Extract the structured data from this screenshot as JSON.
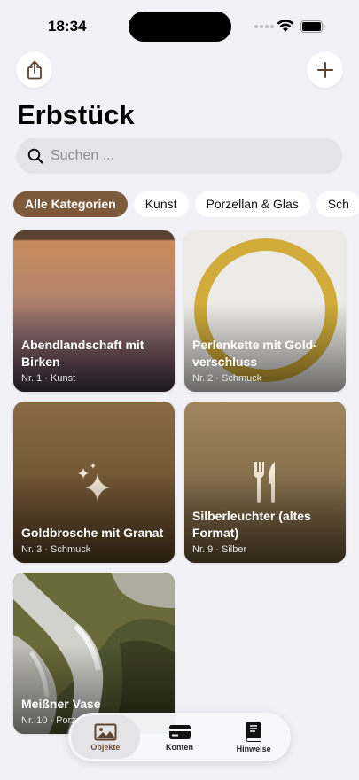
{
  "status_bar": {
    "time": "18:34"
  },
  "header": {
    "title": "Erbstück",
    "share_icon": "share-icon",
    "add_icon": "plus-icon"
  },
  "search": {
    "placeholder": "Suchen ...",
    "value": ""
  },
  "categories": [
    {
      "label": "Alle Kategorien",
      "active": true
    },
    {
      "label": "Kunst",
      "active": false
    },
    {
      "label": "Porzellan & Glas",
      "active": false
    },
    {
      "label": "Sch",
      "active": false
    }
  ],
  "items": [
    {
      "title": "Abendlandschaft mit Birken",
      "subtitle": "Nr. 1 · Kunst"
    },
    {
      "title": "Perlenkette mit Gold­verschluss",
      "subtitle": "Nr. 2 · Schmuck"
    },
    {
      "title": "Goldbrosche mit Granat",
      "subtitle": "Nr. 3 · Schmuck",
      "icon": "sparkles-icon"
    },
    {
      "title": "Silberleuchter (altes Format)",
      "subtitle": "Nr. 9 · Silber",
      "icon": "fork-knife-icon"
    },
    {
      "title": "Meißner Vase",
      "subtitle": "Nr. 10 · Porz"
    }
  ],
  "tabs": [
    {
      "label": "Objekte",
      "icon": "photo-icon",
      "active": true
    },
    {
      "label": "Konten",
      "icon": "credit-card-icon",
      "active": false
    },
    {
      "label": "Hinweise",
      "icon": "book-icon",
      "active": false
    }
  ],
  "colors": {
    "accent": "#7d5a3c",
    "background": "#f2f2f6"
  }
}
